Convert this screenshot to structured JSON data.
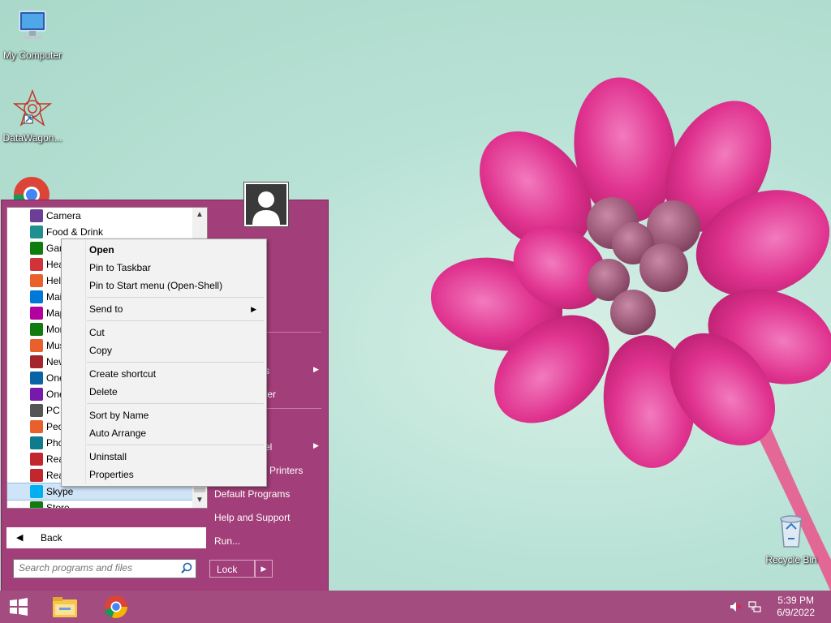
{
  "desktop": {
    "icons": [
      {
        "label": "My Computer",
        "icon": "computer-icon"
      },
      {
        "label": "DataWagon...",
        "icon": "datawagon-icon"
      },
      {
        "label": "Recycle Bin",
        "icon": "recycle-bin-icon"
      }
    ]
  },
  "start_menu": {
    "programs": [
      {
        "label": "Camera",
        "color": "#6b3f96"
      },
      {
        "label": "Food & Drink",
        "color": "#1f8f8f"
      },
      {
        "label": "Games",
        "color": "#107c10"
      },
      {
        "label": "Health & Fitness",
        "color": "#d13438"
      },
      {
        "label": "Help+Tips",
        "color": "#e8612c"
      },
      {
        "label": "Mail",
        "color": "#0078d7"
      },
      {
        "label": "Maps",
        "color": "#b4009e"
      },
      {
        "label": "Money",
        "color": "#107c10"
      },
      {
        "label": "Music",
        "color": "#e8612c"
      },
      {
        "label": "News",
        "color": "#a4262c"
      },
      {
        "label": "OneDrive",
        "color": "#0a64a4"
      },
      {
        "label": "OneNote",
        "color": "#7719aa"
      },
      {
        "label": "PC settings",
        "color": "#555555"
      },
      {
        "label": "People",
        "color": "#e8612c"
      },
      {
        "label": "Photos",
        "color": "#0f7b8c"
      },
      {
        "label": "Reading List",
        "color": "#c1272d"
      },
      {
        "label": "Reader",
        "color": "#c1272d"
      },
      {
        "label": "Skype",
        "color": "#00aff0"
      },
      {
        "label": "Store",
        "color": "#107c10"
      }
    ],
    "selected_index": 17,
    "back_label": "Back",
    "search_placeholder": "Search programs and files",
    "right_items": [
      {
        "label": "s",
        "has_submenu": true
      },
      {
        "label": "ter",
        "has_submenu": false
      },
      {
        "label": "el",
        "has_submenu": true
      },
      {
        "label": "Printers",
        "has_submenu": false
      },
      {
        "label": "Default Programs",
        "has_submenu": false
      },
      {
        "label": "Help and Support",
        "has_submenu": false
      },
      {
        "label": "Run...",
        "has_submenu": false
      }
    ],
    "lock_label": "Lock",
    "accent": "#a23e79"
  },
  "context_menu": {
    "items": [
      {
        "label": "Open",
        "bold": true
      },
      {
        "label": "Pin to Taskbar"
      },
      {
        "label": "Pin to Start menu (Open-Shell)"
      },
      {
        "label": "Send to",
        "submenu": true
      },
      {
        "label": "Cut"
      },
      {
        "label": "Copy"
      },
      {
        "label": "Create shortcut"
      },
      {
        "label": "Delete"
      },
      {
        "label": "Sort by Name"
      },
      {
        "label": "Auto Arrange"
      },
      {
        "label": "Uninstall"
      },
      {
        "label": "Properties"
      }
    ]
  },
  "taskbar": {
    "time": "5:39 PM",
    "date": "6/9/2022",
    "color": "#a24c7f",
    "apps": [
      "start-button",
      "file-explorer-icon",
      "chrome-icon"
    ]
  }
}
